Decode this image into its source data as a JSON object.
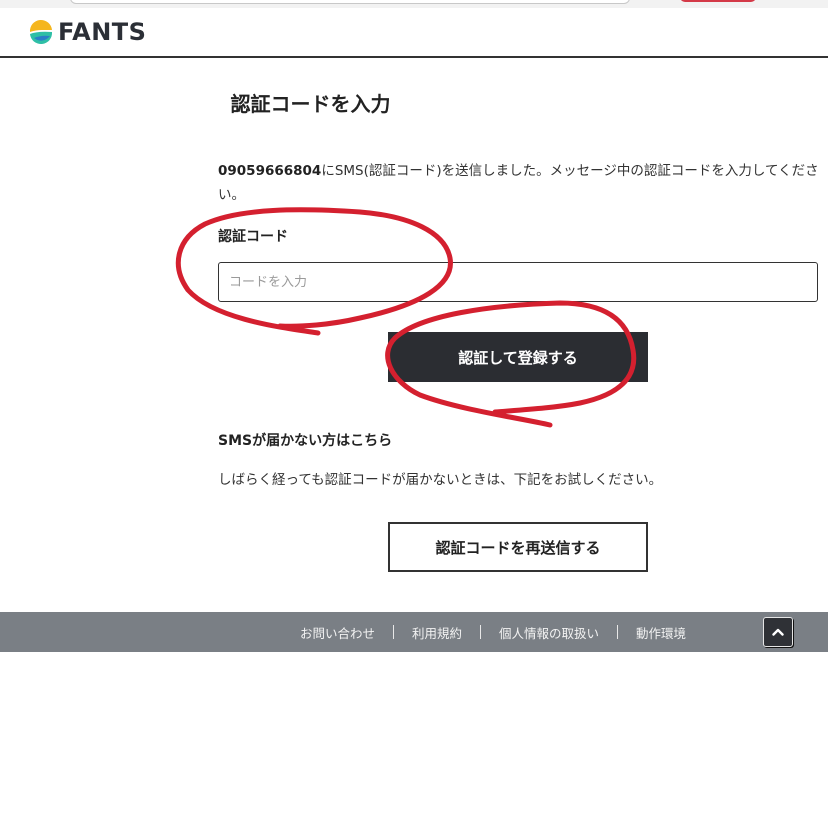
{
  "brand": {
    "name": "FANTS"
  },
  "page": {
    "title": "認証コードを入力"
  },
  "message": {
    "phone": "09059666804",
    "text": "にSMS(認証コード)を送信しました。メッセージ中の認証コードを入力してください。"
  },
  "form": {
    "code_label": "認証コード",
    "code_placeholder": "コードを入力",
    "code_value": "",
    "submit_label": "認証して登録する"
  },
  "help": {
    "heading": "SMSが届かない方はこちら",
    "description": "しばらく経っても認証コードが届かないときは、下記をお試しください。",
    "resend_label": "認証コードを再送信する"
  },
  "footer": {
    "links": [
      "お問い合わせ",
      "利用規約",
      "個人情報の取扱い",
      "動作環境"
    ]
  },
  "colors": {
    "primary_button": "#2b2d32",
    "footer": "#7a7f85",
    "annotation": "#d4202f"
  },
  "icons": {
    "logo": "fants-logo-icon",
    "scroll_top": "chevron-up-icon"
  }
}
